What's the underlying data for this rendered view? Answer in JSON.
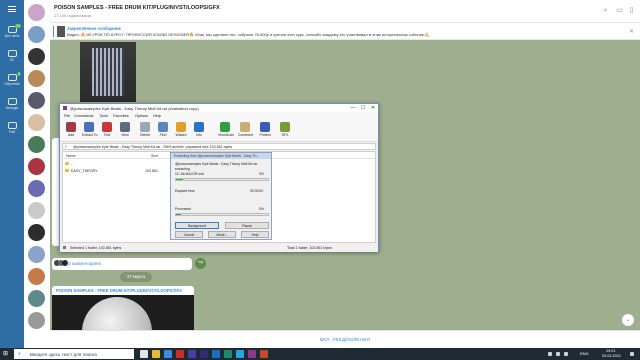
{
  "telegram": {
    "sidebar": [
      {
        "label": "Все чаты",
        "badge": "20"
      },
      {
        "label": "ЛС",
        "badge": ""
      },
      {
        "label": "Обучение",
        "badge": "2"
      },
      {
        "label": "Беседы",
        "badge": ""
      },
      {
        "label": "Раб",
        "badge": ""
      }
    ],
    "header": {
      "title": "POISON SAMPLES - FREE DRUM KIT/PLUGIN/VST/LOOPS/GFX",
      "subscribers": "17 145 подписчиков"
    },
    "pinned": {
      "title": "Закреплённое сообщение",
      "text": "Видео, 🔥1Й УРОК ПО КУРСУ: ПРОФЕССИЯ SOUND DESIGNER🔥 Итак, мы сделали это, собрали 78.600р и купили этот курс, спасибо каждому кто участвовал в этом историческом событии🙏"
    },
    "comments_label": "25 комментариев",
    "date_pill": "27 марта",
    "post2_title": "POISON SAMPLES - FREE DRUM KIT/PLUGIN/VST/LOOPS/GFX",
    "notify_label": "ВКЛ. УВЕДОМЛЕНИЯ",
    "accent": "#3a8ed4"
  },
  "winrar": {
    "title": "@poisonsamples Kyle Beats - Easy Theory Midi Kit.rar (evaluation copy)",
    "window_buttons": [
      "—",
      "☐",
      "✕"
    ],
    "menu": [
      "File",
      "Commands",
      "Tools",
      "Favorites",
      "Options",
      "Help"
    ],
    "toolbar": [
      {
        "label": "Add",
        "color": "#a33a4b",
        "icon": "add-icon"
      },
      {
        "label": "Extract To",
        "color": "#4a6fbd",
        "icon": "extract-icon"
      },
      {
        "label": "Test",
        "color": "#c73838",
        "icon": "test-icon"
      },
      {
        "label": "View",
        "color": "#5d6b7d",
        "icon": "view-icon"
      },
      {
        "label": "Delete",
        "color": "#9aa7b7",
        "icon": "delete-icon"
      },
      {
        "label": "Find",
        "color": "#5a86c0",
        "icon": "find-icon"
      },
      {
        "label": "Wizard",
        "color": "#e0a02b",
        "icon": "wizard-icon"
      },
      {
        "label": "Info",
        "color": "#2d72c9",
        "icon": "info-icon"
      },
      {
        "label": "VirusScan",
        "color": "#2ea043",
        "icon": "virusscan-icon"
      },
      {
        "label": "Comment",
        "color": "#c8ae74",
        "icon": "comment-icon"
      },
      {
        "label": "Protect",
        "color": "#3b5cb8",
        "icon": "protect-icon"
      },
      {
        "label": "SFX",
        "color": "#7a9a3a",
        "icon": "sfx-icon"
      }
    ],
    "path": "@poisonsamples Kyle Beats - Easy Theory Midi Kit.rar - RAR archive, unpacked size 103 851 bytes",
    "columns": [
      "Name",
      "Size"
    ],
    "files": [
      {
        "name": "..",
        "size": ""
      },
      {
        "name": "EASY_THEORY",
        "size": "103 851"
      }
    ],
    "status_left": "Selected 1 folder, 103 851 bytes",
    "status_right": "Total 1 folder, 103 851 bytes"
  },
  "extract_dialog": {
    "title": "Extracting from @poisonsamples Kyle Beats - Easy Th...",
    "archive": "@poisonsamples Kyle Beats - Easy Theory Midi Kit.rar",
    "action": "extracting",
    "file": "12. Ab MAJOR.mid",
    "file_pct": "0%",
    "file_progress": 0.08,
    "elapsed_label": "Elapsed time",
    "elapsed_value": "00:00:00",
    "processed_label": "Processed",
    "processed_pct": "0%",
    "processed_progress": 0.05,
    "buttons": {
      "background": "Background",
      "pause": "Pause",
      "cancel": "Cancel",
      "mode": "Mode...",
      "help": "Help"
    }
  },
  "taskbar": {
    "search_placeholder": "Введите здесь текст для поиска",
    "lang": "ENG",
    "time": "19:21",
    "date": "20.04.2021",
    "apps": [
      {
        "name": "task-view-icon",
        "color": "#dfe4ea"
      },
      {
        "name": "file-explorer-icon",
        "color": "#e8b93b"
      },
      {
        "name": "edge-icon",
        "color": "#3c8ce0"
      },
      {
        "name": "opera-icon",
        "color": "#d02b2b"
      },
      {
        "name": "premiere-icon",
        "color": "#4a3ea8"
      },
      {
        "name": "after-effects-icon",
        "color": "#2f2a7a"
      },
      {
        "name": "photoshop-icon",
        "color": "#1b6fc2"
      },
      {
        "name": "audition-icon",
        "color": "#1f8b6e"
      },
      {
        "name": "telegram-icon",
        "color": "#2aa3e0"
      },
      {
        "name": "winrar-icon",
        "color": "#8a3a8a"
      },
      {
        "name": "app-icon",
        "color": "#c54a2a"
      }
    ]
  }
}
